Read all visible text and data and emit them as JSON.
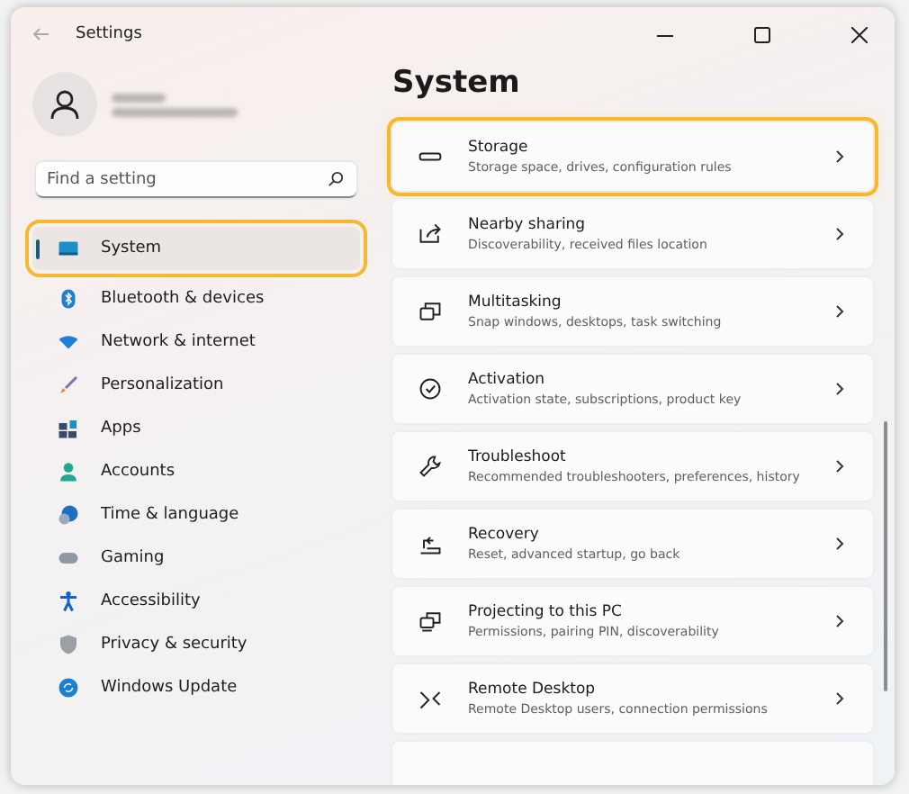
{
  "window": {
    "title": "Settings"
  },
  "search": {
    "placeholder": "Find a setting"
  },
  "nav": [
    {
      "label": "System",
      "selected": true,
      "highlighted": true
    },
    {
      "label": "Bluetooth & devices",
      "selected": false,
      "highlighted": false
    },
    {
      "label": "Network & internet",
      "selected": false,
      "highlighted": false
    },
    {
      "label": "Personalization",
      "selected": false,
      "highlighted": false
    },
    {
      "label": "Apps",
      "selected": false,
      "highlighted": false
    },
    {
      "label": "Accounts",
      "selected": false,
      "highlighted": false
    },
    {
      "label": "Time & language",
      "selected": false,
      "highlighted": false
    },
    {
      "label": "Gaming",
      "selected": false,
      "highlighted": false
    },
    {
      "label": "Accessibility",
      "selected": false,
      "highlighted": false
    },
    {
      "label": "Privacy & security",
      "selected": false,
      "highlighted": false
    },
    {
      "label": "Windows Update",
      "selected": false,
      "highlighted": false
    }
  ],
  "page": {
    "title": "System"
  },
  "cards": [
    {
      "title": "Storage",
      "subtitle": "Storage space, drives, configuration rules",
      "highlighted": true
    },
    {
      "title": "Nearby sharing",
      "subtitle": "Discoverability, received files location",
      "highlighted": false
    },
    {
      "title": "Multitasking",
      "subtitle": "Snap windows, desktops, task switching",
      "highlighted": false
    },
    {
      "title": "Activation",
      "subtitle": "Activation state, subscriptions, product key",
      "highlighted": false
    },
    {
      "title": "Troubleshoot",
      "subtitle": "Recommended troubleshooters, preferences, history",
      "highlighted": false
    },
    {
      "title": "Recovery",
      "subtitle": "Reset, advanced startup, go back",
      "highlighted": false
    },
    {
      "title": "Projecting to this PC",
      "subtitle": "Permissions, pairing PIN, discoverability",
      "highlighted": false
    },
    {
      "title": "Remote Desktop",
      "subtitle": "Remote Desktop users, connection permissions",
      "highlighted": false
    }
  ]
}
